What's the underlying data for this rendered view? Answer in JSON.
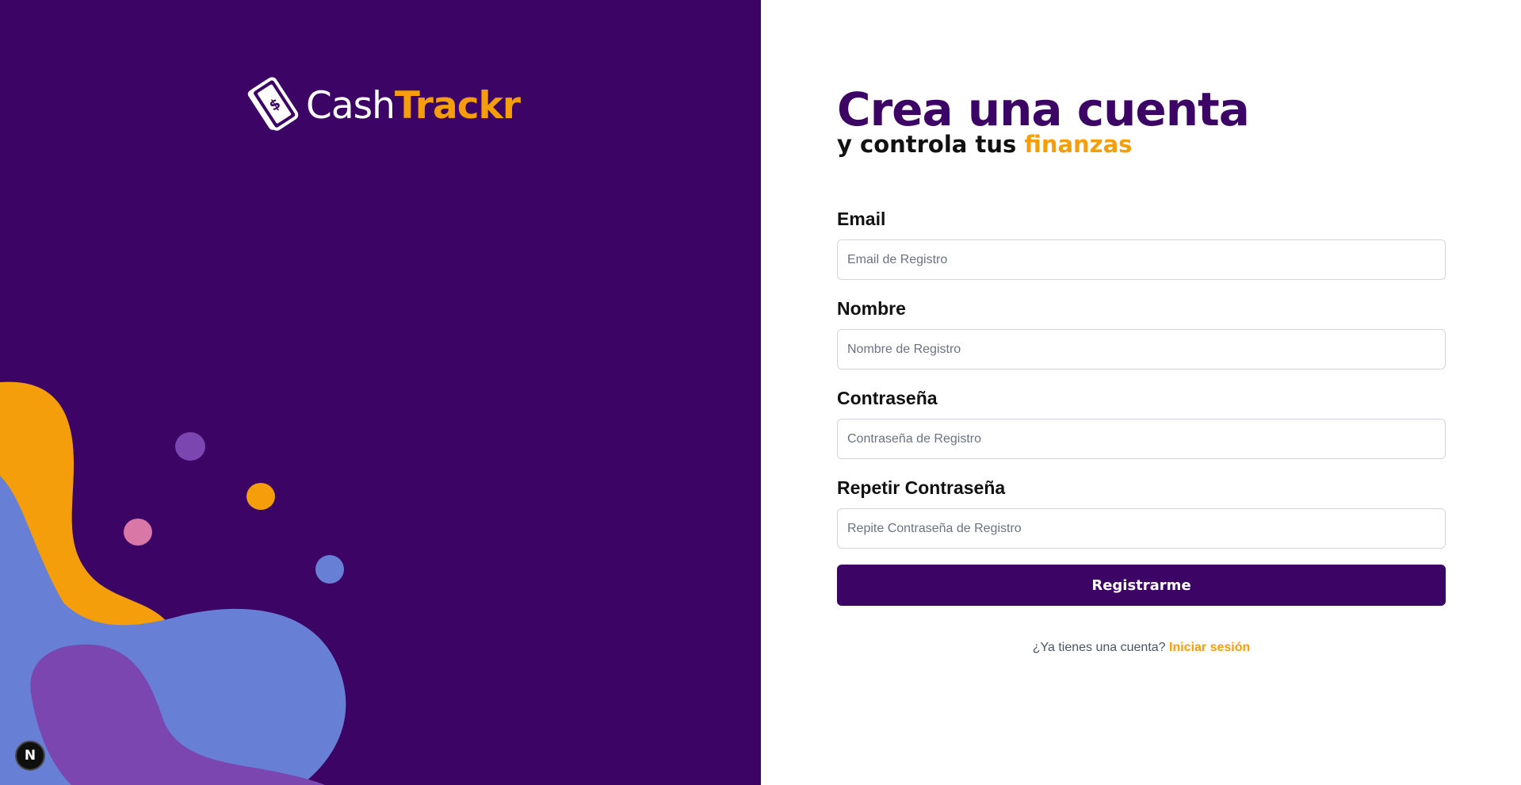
{
  "brand": {
    "name_part1": "Cash",
    "name_part2": "Trackr",
    "icon": "money-bills-icon"
  },
  "colors": {
    "primary_purple": "#3c0465",
    "accent_orange": "#f59e0b",
    "blob_blue": "#6780d6",
    "blob_violet": "#7b46b0",
    "blob_pink": "#d977a6"
  },
  "header": {
    "title": "Crea una cuenta",
    "subtitle_prefix": "y controla tus ",
    "subtitle_accent": "finanzas"
  },
  "form": {
    "email": {
      "label": "Email",
      "placeholder": "Email de Registro",
      "value": ""
    },
    "nombre": {
      "label": "Nombre",
      "placeholder": "Nombre de Registro",
      "value": ""
    },
    "password": {
      "label": "Contraseña",
      "placeholder": "Contraseña de Registro",
      "value": ""
    },
    "password_confirm": {
      "label": "Repetir Contraseña",
      "placeholder": "Repite Contraseña de Registro",
      "value": ""
    },
    "submit_label": "Registrarme"
  },
  "footer": {
    "question": "¿Ya tienes una cuenta? ",
    "login_link": "Iniciar sesión"
  },
  "dev_badge": {
    "letter": "N",
    "icon": "nextjs-logo-icon"
  }
}
